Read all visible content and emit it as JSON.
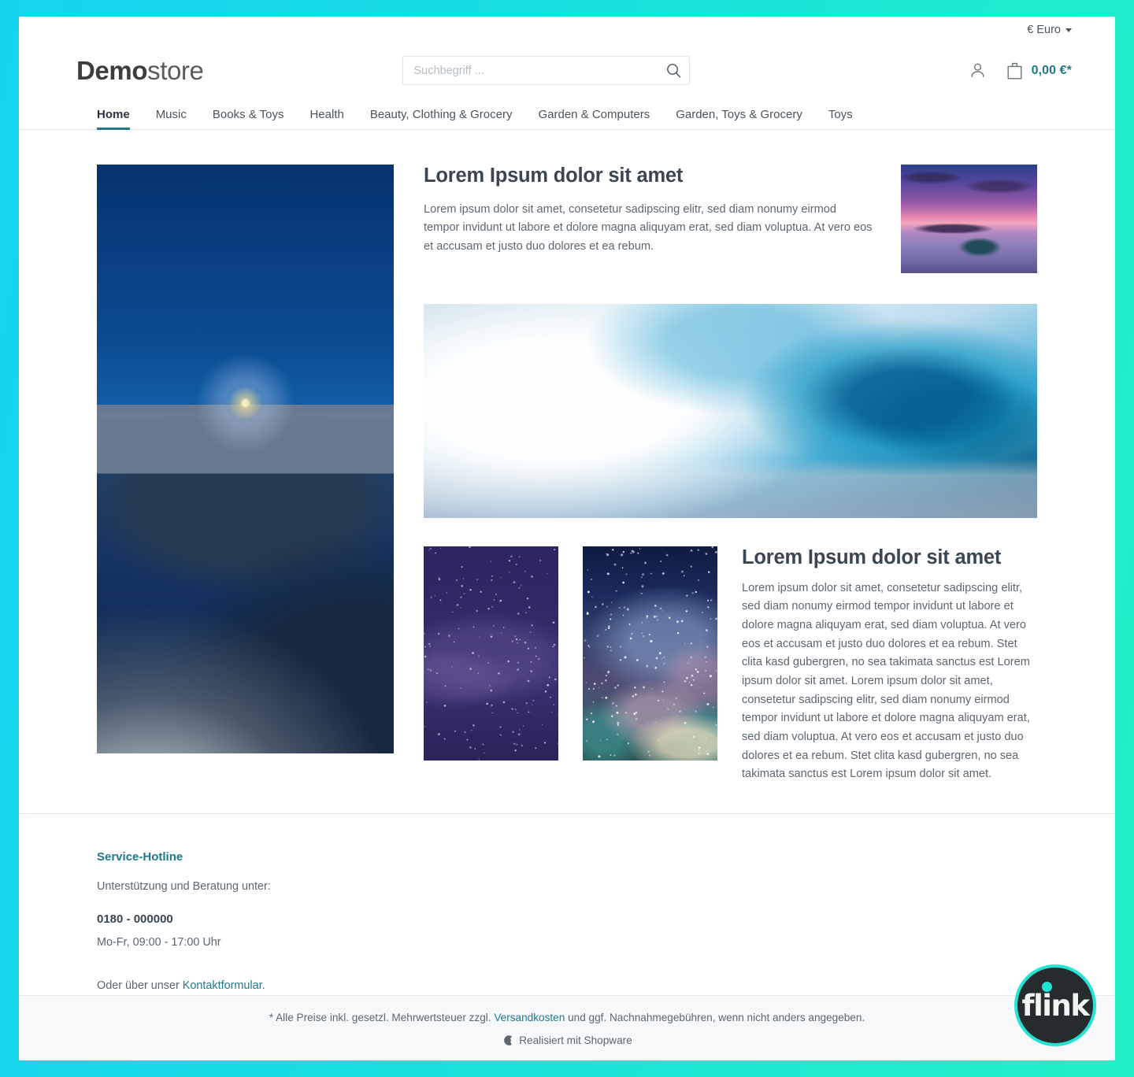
{
  "theme": {
    "border_gradient_start": "#14d3ef",
    "border_gradient_end": "#1ff0c6",
    "accent": "#1d7a8c",
    "nav_active_underline": "#25788a",
    "text": "#5c6670",
    "heading": "#3a4652"
  },
  "topbar": {
    "currency_label": "€ Euro",
    "currency_caret_icon": "chevron-down-icon"
  },
  "header": {
    "logo_bold": "Demo",
    "logo_light": "store",
    "search": {
      "placeholder": "Suchbegriff ...",
      "value": "",
      "icon": "search-icon"
    },
    "account_icon": "user-icon",
    "cart_icon": "shopping-bag-icon",
    "cart_total": "0,00 €*"
  },
  "nav": {
    "items": [
      {
        "label": "Home",
        "active": true
      },
      {
        "label": "Music",
        "active": false
      },
      {
        "label": "Books & Toys",
        "active": false
      },
      {
        "label": "Health",
        "active": false
      },
      {
        "label": "Beauty, Clothing & Grocery",
        "active": false
      },
      {
        "label": "Garden & Computers",
        "active": false
      },
      {
        "label": "Garden, Toys & Grocery",
        "active": false
      },
      {
        "label": "Toys",
        "active": false
      }
    ]
  },
  "main": {
    "images": {
      "lighthouse_alt": "lighthouse-at-blue-hour-image",
      "sunset_alt": "sunset-boat-image",
      "wave_alt": "ocean-wave-image",
      "stars_alt": "purple-starfield-image",
      "galaxy_alt": "milky-way-galaxy-image"
    },
    "hero": {
      "title": "Lorem Ipsum dolor sit amet",
      "text": "Lorem ipsum dolor sit amet, consetetur sadipscing elitr, sed diam nonumy eirmod tempor invidunt ut labore et dolore magna aliquyam erat, sed diam voluptua. At vero eos et accusam et justo duo dolores et ea rebum."
    },
    "secondary": {
      "title": "Lorem Ipsum dolor sit amet",
      "text": "Lorem ipsum dolor sit amet, consetetur sadipscing elitr, sed diam nonumy eirmod tempor invidunt ut labore et dolore magna aliquyam erat, sed diam voluptua. At vero eos et accusam et justo duo dolores et ea rebum. Stet clita kasd gubergren, no sea takimata sanctus est Lorem ipsum dolor sit amet. Lorem ipsum dolor sit amet, consetetur sadipscing elitr, sed diam nonumy eirmod tempor invidunt ut labore et dolore magna aliquyam erat, sed diam voluptua. At vero eos et accusam et justo duo dolores et ea rebum. Stet clita kasd gubergren, no sea takimata sanctus est Lorem ipsum dolor sit amet."
    }
  },
  "footer": {
    "hotline_title": "Service-Hotline",
    "hotline_sub": "Unterstützung und Beratung unter:",
    "phone": "0180 - 000000",
    "hours": "Mo-Fr, 09:00 - 17:00 Uhr",
    "contact_prefix": "Oder über unser ",
    "contact_link": "Kontaktformular",
    "contact_suffix": "."
  },
  "bottombar": {
    "legal_prefix": "* Alle Preise inkl. gesetzl. Mehrwertsteuer zzgl. ",
    "legal_link": "Versandkosten",
    "legal_suffix": " und ggf. Nachnahmegebühren, wenn nicht anders angegeben.",
    "powered_icon": "shopware-logo-icon",
    "powered_label": "Realisiert mit Shopware"
  },
  "badge": {
    "label": "flink",
    "ring_color": "#22e3d4",
    "bg_color": "#262b2e"
  }
}
